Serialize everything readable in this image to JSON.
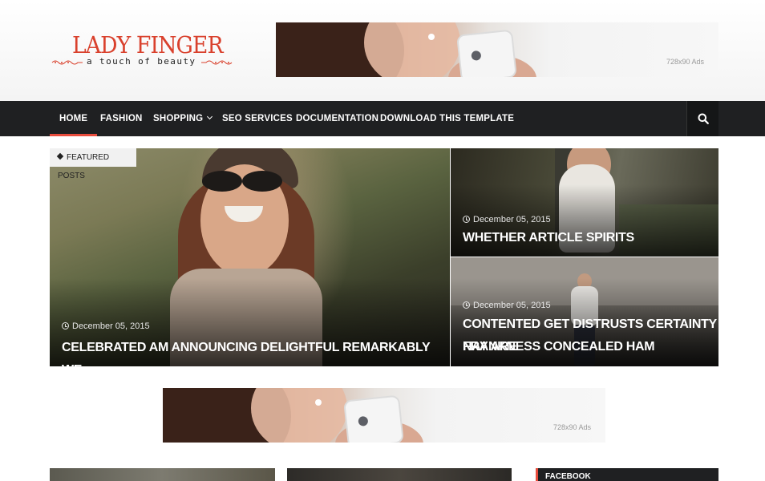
{
  "header": {
    "logo_title": "LADY FINGER",
    "logo_tagline": "a touch of beauty",
    "ad_top_label": "728x90 Ads"
  },
  "nav": {
    "items": [
      {
        "label": "HOME",
        "active": true
      },
      {
        "label": "FASHION"
      },
      {
        "label": "SHOPPING",
        "has_dropdown": true
      },
      {
        "label": "SEO SERVICES"
      },
      {
        "label": "DOCUMENTATION"
      },
      {
        "label": "DOWNLOAD THIS TEMPLATE"
      }
    ],
    "search_icon": "search-icon"
  },
  "featured": {
    "badge": "FEATURED POSTS",
    "posts": [
      {
        "date": "December 05, 2015",
        "title": "CELEBRATED AM ANNOUNCING DELIGHTFUL REMARKABLY WE"
      },
      {
        "date": "December 05, 2015",
        "title": "WHETHER ARTICLE SPIRITS"
      },
      {
        "date": "December 05, 2015",
        "title_line1": "CONTENTED GET DISTRUSTS CERTAINTY NAY ARE",
        "title_line2": "FRANKNESS CONCEALED HAM"
      }
    ]
  },
  "ad_mid_label": "728x90 Ads",
  "sidebar": {
    "widget_title": "FACEBOOK"
  },
  "colors": {
    "accent": "#e84c3d",
    "nav_bg": "#1f2022",
    "logo": "#d9412d"
  }
}
